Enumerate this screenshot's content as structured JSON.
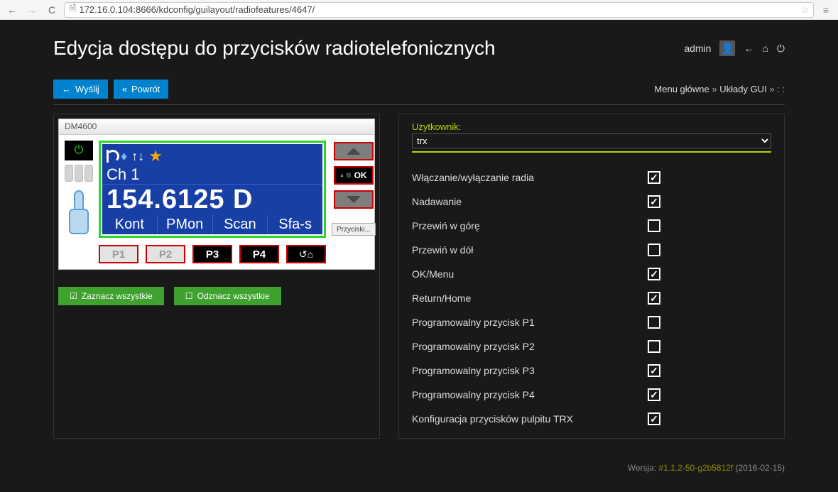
{
  "browser": {
    "url": "172.16.0.104:8666/kdconfig/guilayout/radiofeatures/4647/"
  },
  "header": {
    "title": "Edycja dostępu do przycisków radiotelefonicznych",
    "user": "admin"
  },
  "toolbar": {
    "send": "Wyślij",
    "back": "Powrót"
  },
  "breadcrumbs": {
    "main": "Menu główne",
    "gui": "Układy GUI",
    "tail": " : :"
  },
  "radio": {
    "title": "DM4600",
    "channel": "Ch 1",
    "frequency": "154.6125 D",
    "tabs": [
      "Kont",
      "PMon",
      "Scan",
      "Sfa-s"
    ],
    "p1": "P1",
    "p2": "P2",
    "p3": "P3",
    "p4": "P4",
    "ok": "▫◾OK",
    "przyciski": "Przyciski..."
  },
  "select_buttons": {
    "select_all": "Zaznacz wszystkie",
    "deselect_all": "Odznacz wszystkie"
  },
  "right": {
    "user_label": "Użytkownik:",
    "user_value": "trx",
    "options": [
      {
        "label": "Włączanie/wyłączanie radia",
        "checked": true
      },
      {
        "label": "Nadawanie",
        "checked": true
      },
      {
        "label": "Przewiń w górę",
        "checked": false
      },
      {
        "label": "Przewiń w dół",
        "checked": false
      },
      {
        "label": "OK/Menu",
        "checked": true
      },
      {
        "label": "Return/Home",
        "checked": true
      },
      {
        "label": "Programowalny przycisk P1",
        "checked": false
      },
      {
        "label": "Programowalny przycisk P2",
        "checked": false
      },
      {
        "label": "Programowalny przycisk P3",
        "checked": true
      },
      {
        "label": "Programowalny przycisk P4",
        "checked": true
      },
      {
        "label": "Konfiguracja przycisków pulpitu TRX",
        "checked": true
      }
    ]
  },
  "footer": {
    "version_label": "Wersja:",
    "version": "#1.1.2-50-g2b5812f",
    "date": "(2016-02-15)"
  }
}
